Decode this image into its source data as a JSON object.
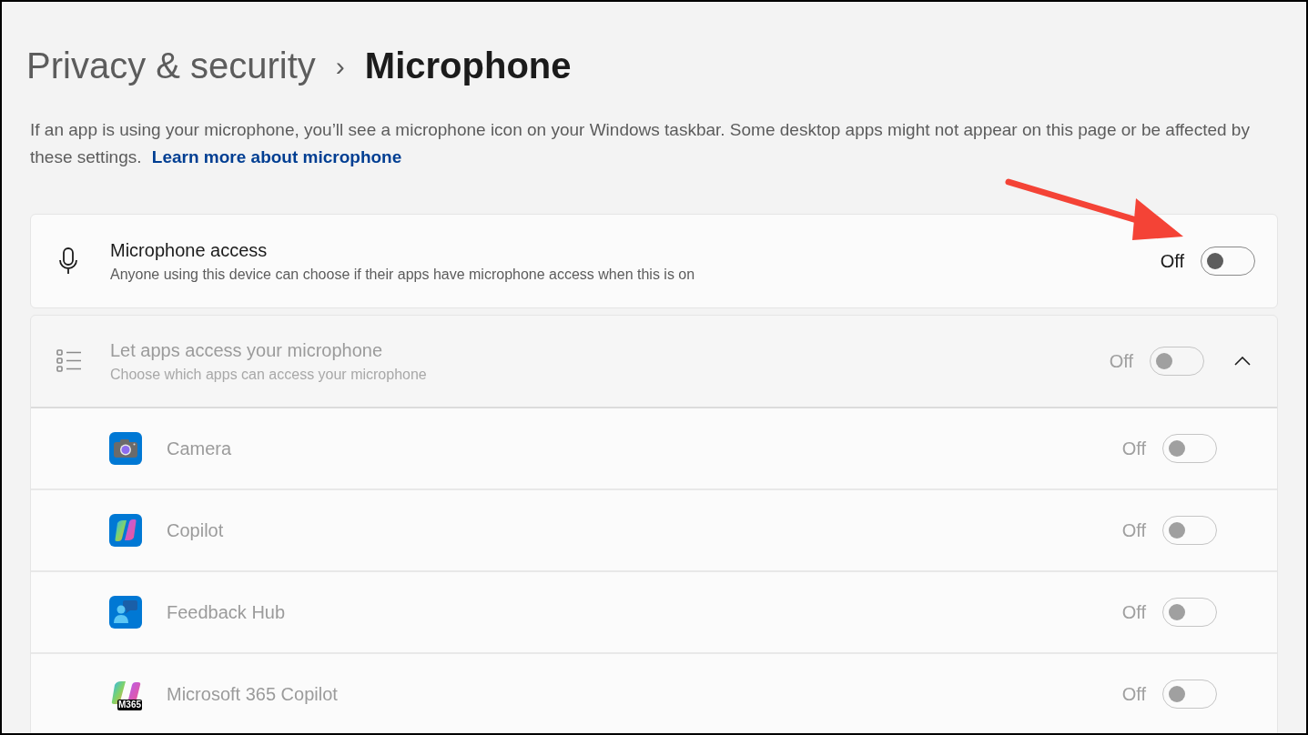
{
  "breadcrumb": {
    "parent": "Privacy & security",
    "separator": "›",
    "current": "Microphone"
  },
  "description": {
    "text": "If an app is using your microphone, you’ll see a microphone icon on your Windows taskbar. Some desktop apps might not appear on this page or be affected by these settings.",
    "link": "Learn more about microphone"
  },
  "microphone_access": {
    "title": "Microphone access",
    "subtitle": "Anyone using this device can choose if their apps have microphone access when this is on",
    "state_label": "Off",
    "on": false,
    "disabled": false
  },
  "app_access": {
    "title": "Let apps access your microphone",
    "subtitle": "Choose which apps can access your microphone",
    "state_label": "Off",
    "on": false,
    "disabled": true,
    "expanded": true,
    "apps": [
      {
        "name": "Camera",
        "state_label": "Off",
        "on": false,
        "disabled": true
      },
      {
        "name": "Copilot",
        "state_label": "Off",
        "on": false,
        "disabled": true
      },
      {
        "name": "Feedback Hub",
        "state_label": "Off",
        "on": false,
        "disabled": true
      },
      {
        "name": "Microsoft 365 Copilot",
        "badge": "M365",
        "state_label": "Off",
        "on": false,
        "disabled": true
      }
    ]
  },
  "annotation": {
    "kind": "arrow"
  }
}
